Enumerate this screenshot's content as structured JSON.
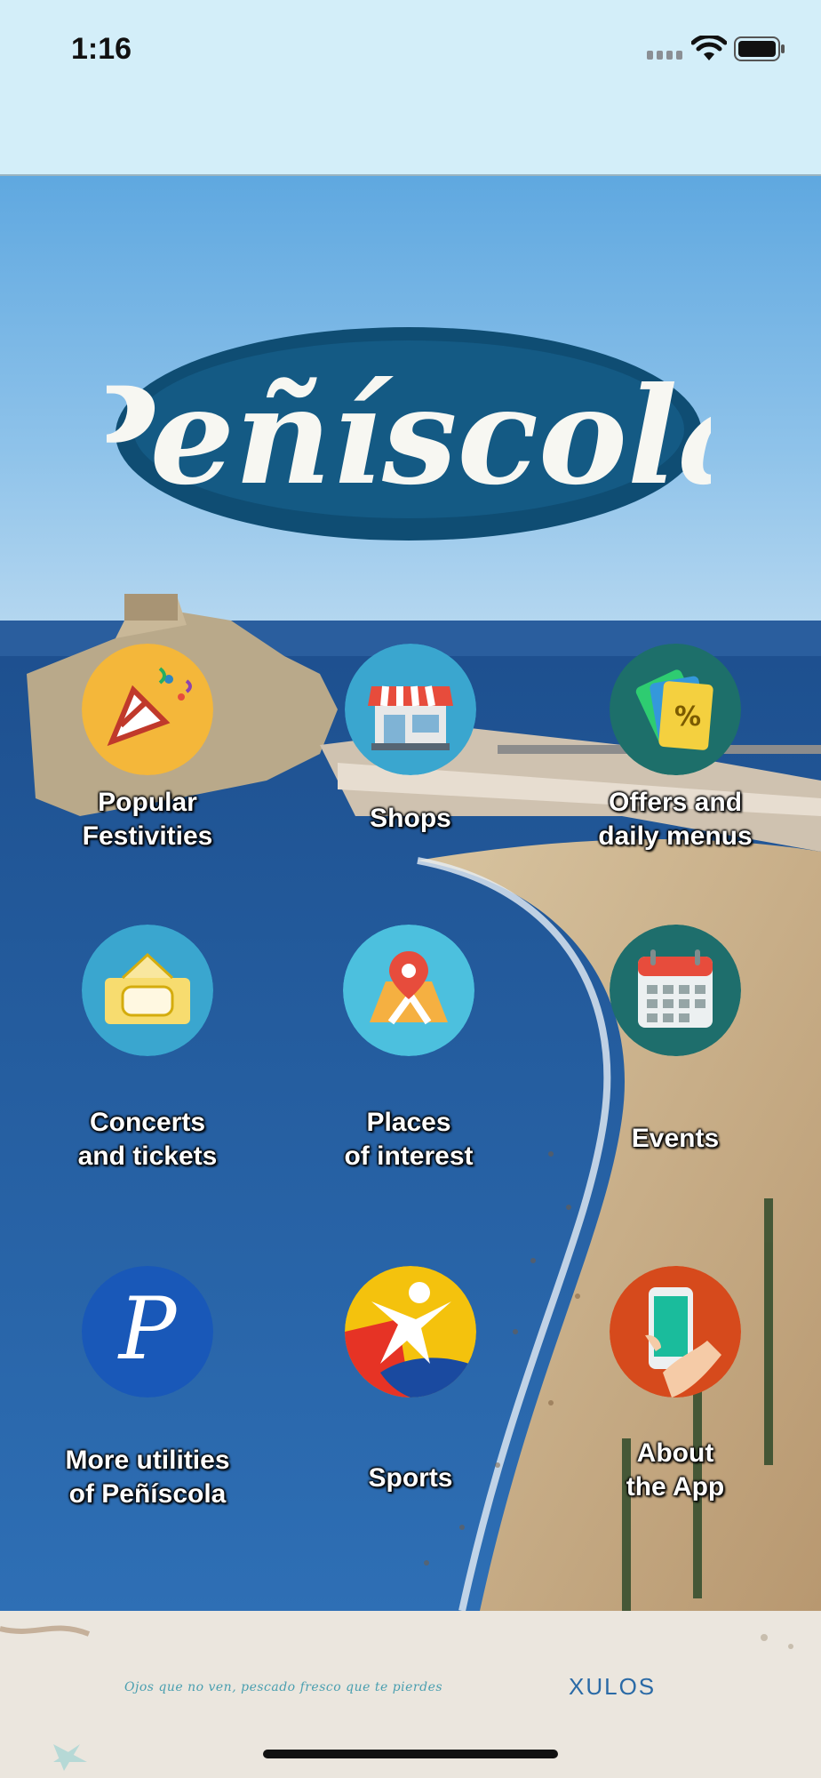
{
  "status_bar": {
    "time": "1:16",
    "icons": [
      "signal-dots-icon",
      "wifi-icon",
      "battery-icon"
    ]
  },
  "logo": {
    "text": "Peñíscola"
  },
  "menu": {
    "items": [
      {
        "label": "Popular\nFestivities",
        "icon": "party-popper-icon",
        "circle_color": "#f4b73a"
      },
      {
        "label": "Shops",
        "icon": "shop-storefront-icon",
        "circle_color": "#3aa6cf"
      },
      {
        "label": "Offers and\ndaily menus",
        "icon": "discount-tags-icon",
        "circle_color": "#1d6f6a"
      },
      {
        "label": "Concerts\nand tickets",
        "icon": "ticket-icon",
        "circle_color": "#3aa6cf"
      },
      {
        "label": "Places\nof interest",
        "icon": "map-pin-icon",
        "circle_color": "#4cc0de"
      },
      {
        "label": "Events",
        "icon": "calendar-icon",
        "circle_color": "#1e6e6c"
      },
      {
        "label": "More utilities\nof Peñíscola",
        "icon": "letter-p-icon",
        "circle_color": "#1958b8"
      },
      {
        "label": "Sports",
        "icon": "sports-figure-icon",
        "circle_color": "#e63325"
      },
      {
        "label": "About\nthe App",
        "icon": "phone-in-hand-icon",
        "circle_color": "#d64a1c"
      }
    ]
  },
  "footer": {
    "tagline": "Ojos que no ven, pescado fresco que te pierdes",
    "brand": "XULOS"
  },
  "colors": {
    "status_bar_bg": "#d3eef9",
    "logo_blue": "#0f4d73",
    "label_text": "#ffffff"
  }
}
